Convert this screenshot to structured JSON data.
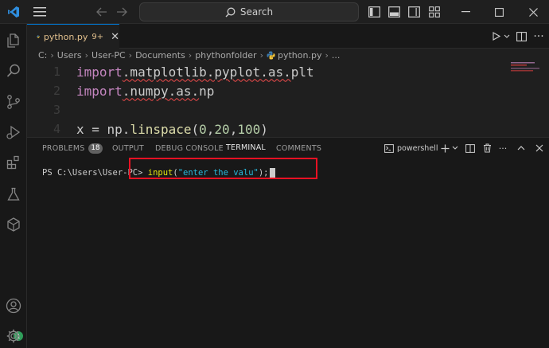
{
  "titlebar": {
    "search_label": "Search"
  },
  "activitybar": {
    "items": [
      "explorer-icon",
      "search-icon",
      "source-control-icon",
      "run-debug-icon",
      "extensions-icon",
      "testing-icon",
      "remote-icon"
    ],
    "accounts_badge": "1"
  },
  "editor": {
    "tab": {
      "filename": "python.py",
      "modified": "9+"
    },
    "breadcrumb": [
      "C:",
      "Users",
      "User-PC",
      "Documents",
      "phythonfolder",
      "python.py",
      "..."
    ],
    "lines": [
      {
        "num": "1",
        "tokens": [
          "import",
          ".matplotlib.pyplot.as.",
          "plt"
        ]
      },
      {
        "num": "2",
        "tokens": [
          "import",
          ".numpy.as.",
          "np"
        ]
      },
      {
        "num": "3",
        "tokens": []
      },
      {
        "num": "4",
        "tokens": [
          "x = np.",
          "linspace",
          "(",
          "0",
          ",",
          "20",
          ",",
          "100",
          ")"
        ]
      }
    ]
  },
  "panel": {
    "tabs": [
      {
        "label": "PROBLEMS",
        "badge": "18"
      },
      {
        "label": "OUTPUT"
      },
      {
        "label": "DEBUG CONSOLE"
      },
      {
        "label": "TERMINAL"
      },
      {
        "label": "COMMENTS"
      }
    ],
    "shell_label": "powershell",
    "terminal": {
      "prompt": "PS C:\\Users\\User-PC> ",
      "cmd_fn": "input",
      "cmd_open": "(",
      "cmd_str": "\"enter the valu\"",
      "cmd_close": ");"
    }
  },
  "colors": {
    "accent": "#0078d4",
    "highlight_box": "#e81123"
  }
}
